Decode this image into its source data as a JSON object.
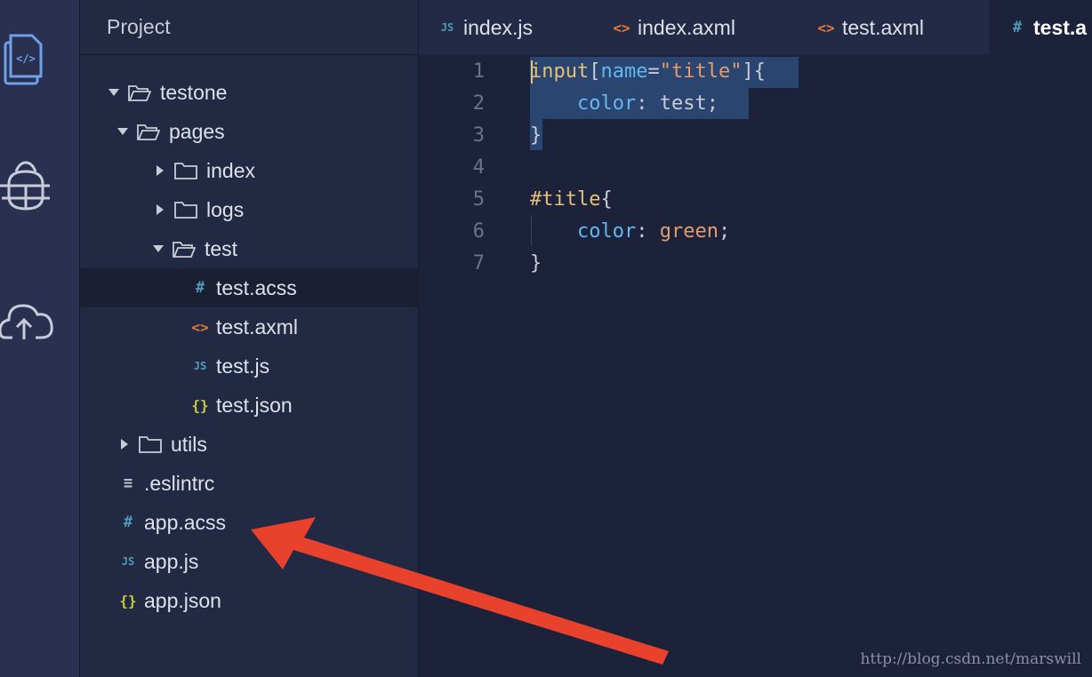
{
  "sidebar": {
    "header": "Project",
    "tree": [
      {
        "label": "testone",
        "kind": "folder-open"
      },
      {
        "label": "pages",
        "kind": "folder-open"
      },
      {
        "label": "index",
        "kind": "folder-closed"
      },
      {
        "label": "logs",
        "kind": "folder-closed"
      },
      {
        "label": "test",
        "kind": "folder-open"
      },
      {
        "label": "test.acss",
        "kind": "file",
        "icon": "#",
        "selected": true
      },
      {
        "label": "test.axml",
        "kind": "file",
        "icon": "<>"
      },
      {
        "label": "test.js",
        "kind": "file",
        "icon": "JS"
      },
      {
        "label": "test.json",
        "kind": "file",
        "icon": "{}"
      },
      {
        "label": "utils",
        "kind": "folder-closed"
      },
      {
        "label": ".eslintrc",
        "kind": "file",
        "icon": "lines"
      },
      {
        "label": "app.acss",
        "kind": "file",
        "icon": "#"
      },
      {
        "label": "app.js",
        "kind": "file",
        "icon": "JS"
      },
      {
        "label": "app.json",
        "kind": "file",
        "icon": "{}"
      }
    ]
  },
  "tabs": [
    {
      "label": "index.js",
      "icon": "JS"
    },
    {
      "label": "index.axml",
      "icon": "<>"
    },
    {
      "label": "test.axml",
      "icon": "<>"
    },
    {
      "label": "test.a",
      "icon": "#",
      "active": true
    }
  ],
  "editor": {
    "line_numbers": [
      "1",
      "2",
      "3",
      "4",
      "5",
      "6",
      "7"
    ],
    "lines": [
      {
        "t1": "input",
        "t2": "[",
        "t3": "name",
        "t4": "=",
        "t5": "\"title\"",
        "t6": "]{"
      },
      {
        "t1": "    ",
        "t2": "color",
        "t3": ": ",
        "t4": "test",
        "t5": ";"
      },
      {
        "t1": "}"
      },
      {
        "t1": ""
      },
      {
        "t1": "#title",
        "t2": "{"
      },
      {
        "t1": "    ",
        "t2": "color",
        "t3": ": ",
        "t4": "green",
        "t5": ";"
      },
      {
        "t1": "}"
      }
    ]
  },
  "watermark": "http://blog.csdn.net/marswill",
  "icons": {
    "activity": [
      "code-file-icon",
      "bug-icon",
      "cloud-upload-icon"
    ]
  },
  "colors": {
    "accent_arrow": "#e8412c"
  }
}
